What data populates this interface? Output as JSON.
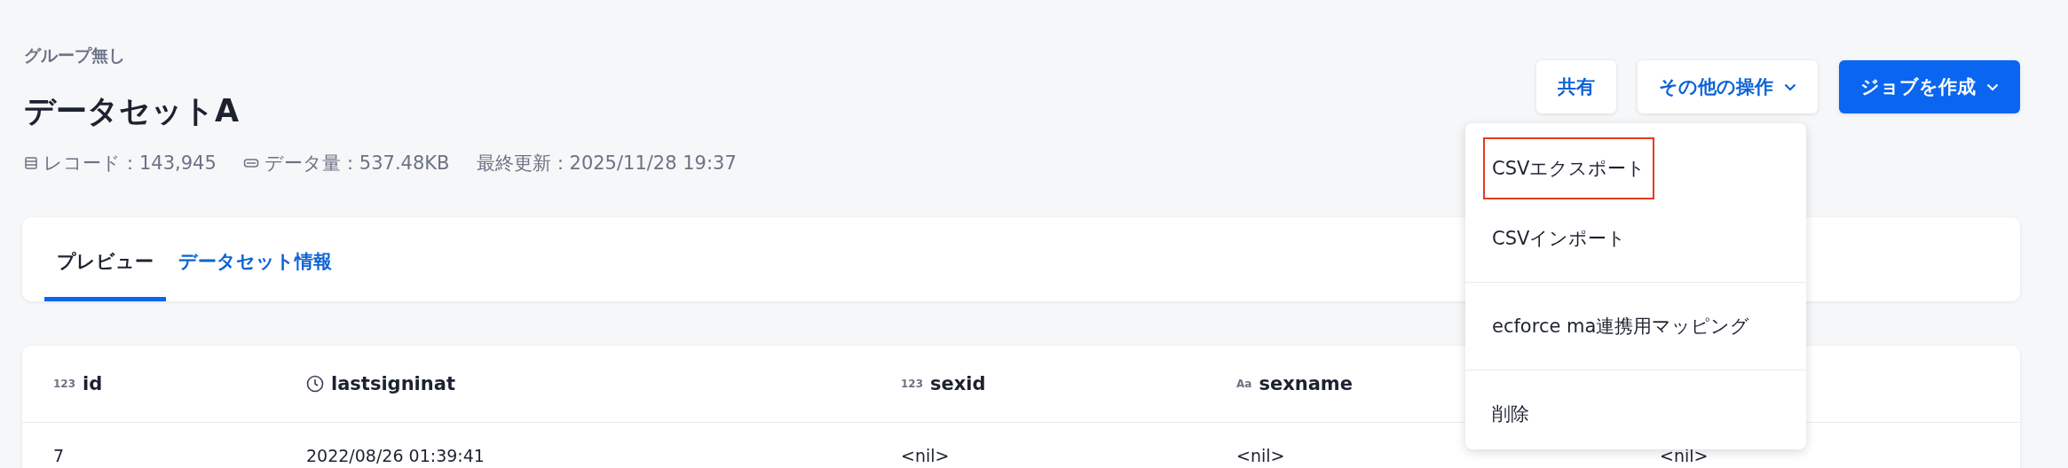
{
  "header": {
    "group": "グループ無し",
    "title": "データセットA",
    "meta": [
      {
        "kind": "records",
        "text": "レコード：143,945"
      },
      {
        "kind": "size",
        "text": "データ量：537.48KB"
      },
      {
        "kind": "updated",
        "text": "最終更新：2025/11/28 19:37"
      }
    ]
  },
  "actions": [
    {
      "label": "共有",
      "kind": "plain",
      "dropdown": false,
      "expanded": false
    },
    {
      "label": "その他の操作",
      "kind": "plain",
      "dropdown": true,
      "expanded": true
    },
    {
      "label": "ジョブを作成",
      "kind": "primary",
      "dropdown": true,
      "expanded": false
    }
  ],
  "menu": {
    "items": [
      {
        "label": "CSVエクスポート",
        "highlighted": true,
        "divider_before": false
      },
      {
        "label": "CSVインポート",
        "highlighted": false,
        "divider_before": false
      },
      {
        "label": "ecforce ma連携用マッピング",
        "highlighted": false,
        "divider_before": true
      },
      {
        "label": "削除",
        "highlighted": false,
        "divider_before": true
      }
    ]
  },
  "tabs": [
    {
      "label": "プレビュー",
      "selected": true
    },
    {
      "label": "データセット情報",
      "selected": false
    }
  ],
  "table": {
    "columns": [
      {
        "name": "id",
        "kind": "number",
        "type_label": "123"
      },
      {
        "name": "lastsigninat",
        "kind": "datetime"
      },
      {
        "name": "sexid",
        "kind": "number",
        "type_label": "123"
      },
      {
        "name": "sexname",
        "kind": "text",
        "type_label": "Aa"
      }
    ],
    "rows": [
      [
        "7",
        "2022/08/26 01:39:41",
        "<nil>",
        "<nil>",
        "<nil>"
      ]
    ]
  }
}
